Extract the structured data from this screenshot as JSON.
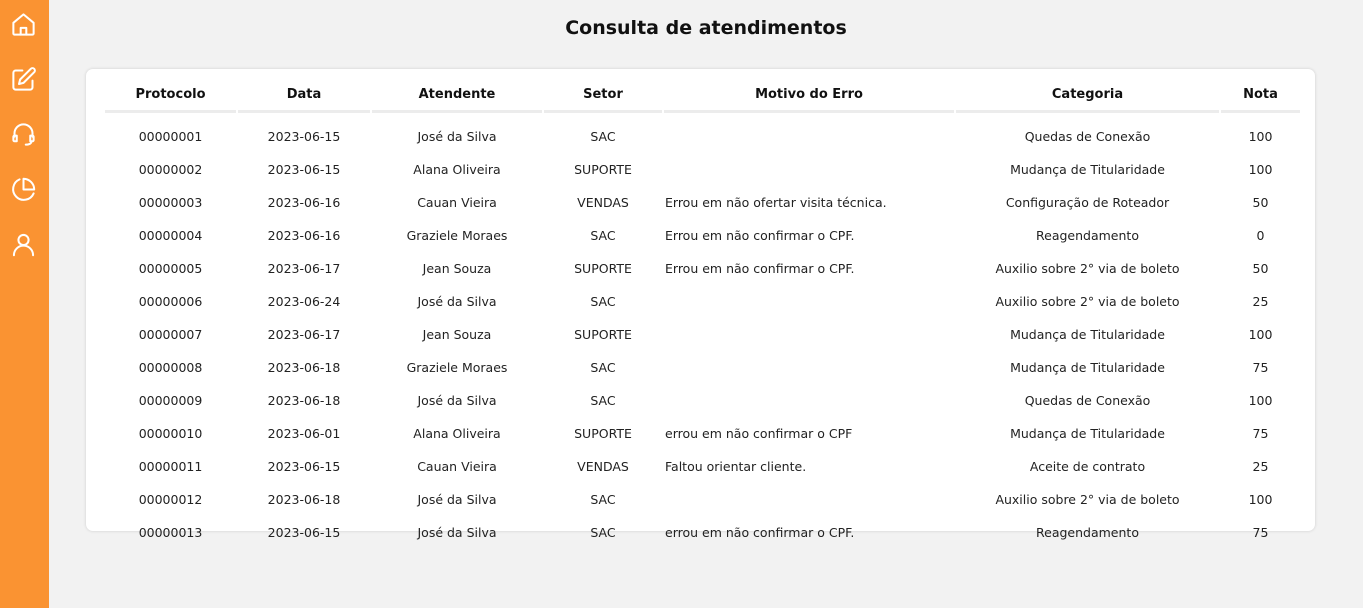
{
  "colors": {
    "sidebar": "#fa9332",
    "background": "#f2f2f2",
    "card": "#ffffff"
  },
  "sidebar": {
    "items": [
      {
        "icon": "home-icon"
      },
      {
        "icon": "edit-icon"
      },
      {
        "icon": "headset-icon"
      },
      {
        "icon": "pie-chart-icon"
      },
      {
        "icon": "user-icon"
      }
    ]
  },
  "page": {
    "title": "Consulta de atendimentos"
  },
  "table": {
    "headers": {
      "protocolo": "Protocolo",
      "data": "Data",
      "atendente": "Atendente",
      "setor": "Setor",
      "motivo": "Motivo do Erro",
      "categoria": "Categoria",
      "nota": "Nota"
    },
    "rows": [
      {
        "protocolo": "00000001",
        "data": "2023-06-15",
        "atendente": "José da Silva",
        "setor": "SAC",
        "motivo": "",
        "categoria": "Quedas de Conexão",
        "nota": "100"
      },
      {
        "protocolo": "00000002",
        "data": "2023-06-15",
        "atendente": "Alana Oliveira",
        "setor": "SUPORTE",
        "motivo": "",
        "categoria": "Mudança de Titularidade",
        "nota": "100"
      },
      {
        "protocolo": "00000003",
        "data": "2023-06-16",
        "atendente": "Cauan Vieira",
        "setor": "VENDAS",
        "motivo": "Errou em não ofertar visita técnica.",
        "categoria": "Configuração de Roteador",
        "nota": "50"
      },
      {
        "protocolo": "00000004",
        "data": "2023-06-16",
        "atendente": "Graziele Moraes",
        "setor": "SAC",
        "motivo": "Errou em não confirmar o CPF.",
        "categoria": "Reagendamento",
        "nota": "0"
      },
      {
        "protocolo": "00000005",
        "data": "2023-06-17",
        "atendente": "Jean Souza",
        "setor": "SUPORTE",
        "motivo": "Errou em não confirmar o CPF.",
        "categoria": "Auxilio sobre 2° via de boleto",
        "nota": "50"
      },
      {
        "protocolo": "00000006",
        "data": "2023-06-24",
        "atendente": "José da Silva",
        "setor": "SAC",
        "motivo": "",
        "categoria": "Auxilio sobre 2° via de boleto",
        "nota": "25"
      },
      {
        "protocolo": "00000007",
        "data": "2023-06-17",
        "atendente": "Jean Souza",
        "setor": "SUPORTE",
        "motivo": "",
        "categoria": "Mudança de Titularidade",
        "nota": "100"
      },
      {
        "protocolo": "00000008",
        "data": "2023-06-18",
        "atendente": "Graziele Moraes",
        "setor": "SAC",
        "motivo": "",
        "categoria": "Mudança de Titularidade",
        "nota": "75"
      },
      {
        "protocolo": "00000009",
        "data": "2023-06-18",
        "atendente": "José da Silva",
        "setor": "SAC",
        "motivo": "",
        "categoria": "Quedas de Conexão",
        "nota": "100"
      },
      {
        "protocolo": "00000010",
        "data": "2023-06-01",
        "atendente": "Alana Oliveira",
        "setor": "SUPORTE",
        "motivo": "errou em não confirmar o CPF",
        "categoria": "Mudança de Titularidade",
        "nota": "75"
      },
      {
        "protocolo": "00000011",
        "data": "2023-06-15",
        "atendente": "Cauan Vieira",
        "setor": "VENDAS",
        "motivo": "Faltou orientar cliente.",
        "categoria": "Aceite de contrato",
        "nota": "25"
      },
      {
        "protocolo": "00000012",
        "data": "2023-06-18",
        "atendente": "José da Silva",
        "setor": "SAC",
        "motivo": "",
        "categoria": "Auxilio sobre 2° via de boleto",
        "nota": "100"
      },
      {
        "protocolo": "00000013",
        "data": "2023-06-15",
        "atendente": "José da Silva",
        "setor": "SAC",
        "motivo": "errou em não confirmar o CPF.",
        "categoria": "Reagendamento",
        "nota": "75"
      }
    ]
  }
}
